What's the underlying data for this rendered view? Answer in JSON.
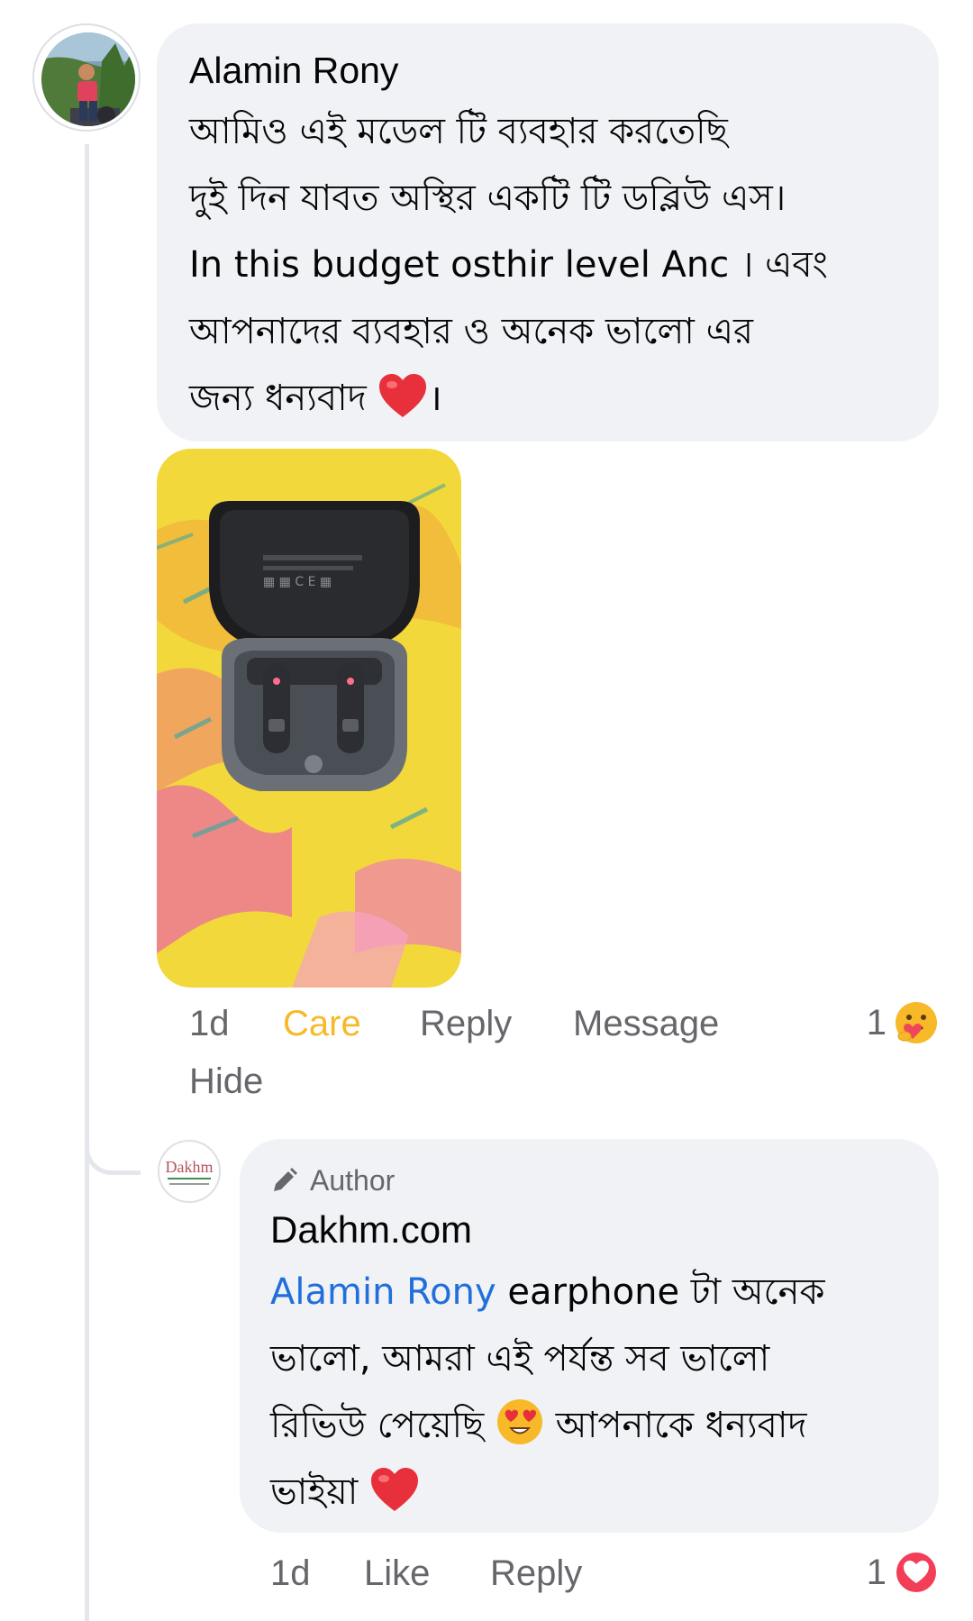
{
  "comment": {
    "author": "Alamin Rony",
    "text_lines": [
      "আমিও এই  মডেল  টি ব্যবহার করতেছি",
      "দুই দিন যাবত অস্থির একটি টি ডব্লিউ এস।",
      "In this budget  osthir level Anc । এবং",
      "আপনাদের ব্যবহার ও অনেক ভালো এর",
      "জন্য ধন্যবাদ"
    ],
    "text_end": "।",
    "time": "1d",
    "reaction_label": "Care",
    "reply_label": "Reply",
    "message_label": "Message",
    "hide_label": "Hide",
    "reaction_count": "1",
    "reaction_icon": "care-reaction-icon"
  },
  "reply": {
    "badge": "Author",
    "author": "Dakhm.com",
    "avatar_logo": "Dakhm",
    "mention": "Alamin Rony",
    "line1_rest": " earphone টা অনেক",
    "line2": "ভালো, আমরা এই পর্যন্ত সব ভালো",
    "line3_a": "রিভিউ পেয়েছি ",
    "line3_b": " আপনাকে ধন্যবাদ",
    "line4": "ভাইয়া ",
    "time": "1d",
    "like_label": "Like",
    "reply_label": "Reply",
    "reaction_count": "1",
    "reaction_icon": "love-reaction-icon"
  },
  "colors": {
    "bubble": "#f0f2f5",
    "care": "#f7b928",
    "mention": "#216fdb",
    "muted": "#65676b",
    "love": "#f33e58"
  }
}
